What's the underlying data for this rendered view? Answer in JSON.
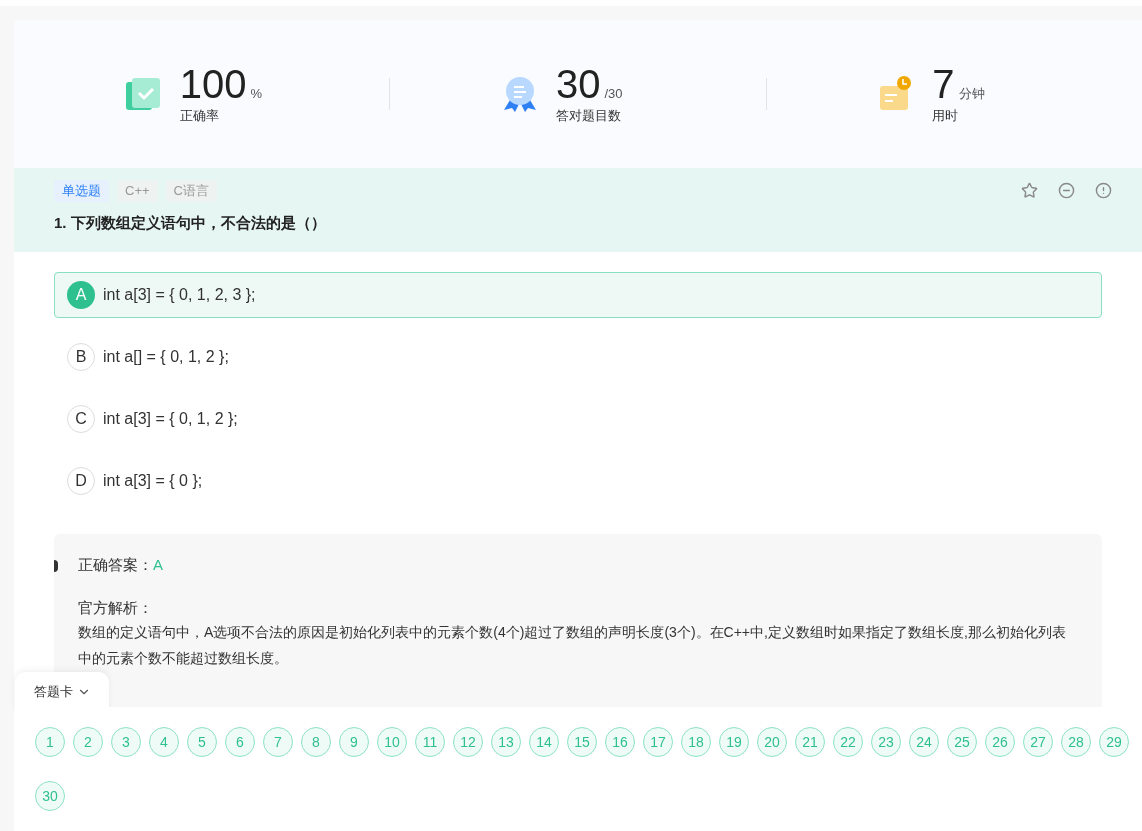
{
  "stats": [
    {
      "kind": "accuracy",
      "value": "100",
      "unit": "%",
      "label": "正确率"
    },
    {
      "kind": "correct",
      "value": "30",
      "unit": "/30",
      "label": "答对题目数"
    },
    {
      "kind": "time",
      "value": "7",
      "unit": "分钟",
      "label": "用时"
    }
  ],
  "question": {
    "tags": [
      {
        "label": "单选题",
        "kind": "type"
      },
      {
        "label": "C++",
        "kind": "topic"
      },
      {
        "label": "C语言",
        "kind": "topic"
      }
    ],
    "title": "1. 下列数组定义语句中，不合法的是（）",
    "options": [
      {
        "letter": "A",
        "text": "int a[3] = { 0, 1, 2, 3 };",
        "selected": true
      },
      {
        "letter": "B",
        "text": "int a[] = { 0, 1, 2 };",
        "selected": false
      },
      {
        "letter": "C",
        "text": "int a[3] = { 0, 1, 2 };",
        "selected": false
      },
      {
        "letter": "D",
        "text": "int a[3] = { 0 };",
        "selected": false
      }
    ]
  },
  "analysis": {
    "answer_label": "正确答案：",
    "answer": "A",
    "explanation_label": "官方解析：",
    "explanation": "数组的定义语句中，A选项不合法的原因是初始化列表中的元素个数(4个)超过了数组的声明长度(3个)。在C++中,定义数组时如果指定了数组长度,那么初始化列表中的元素个数不能超过数组长度。"
  },
  "answer_card": {
    "title": "答题卡",
    "numbers": [
      "1",
      "2",
      "3",
      "4",
      "5",
      "6",
      "7",
      "8",
      "9",
      "10",
      "11",
      "12",
      "13",
      "14",
      "15",
      "16",
      "17",
      "18",
      "19",
      "20",
      "21",
      "22",
      "23",
      "24",
      "25",
      "26",
      "27",
      "28",
      "29",
      "30"
    ]
  }
}
